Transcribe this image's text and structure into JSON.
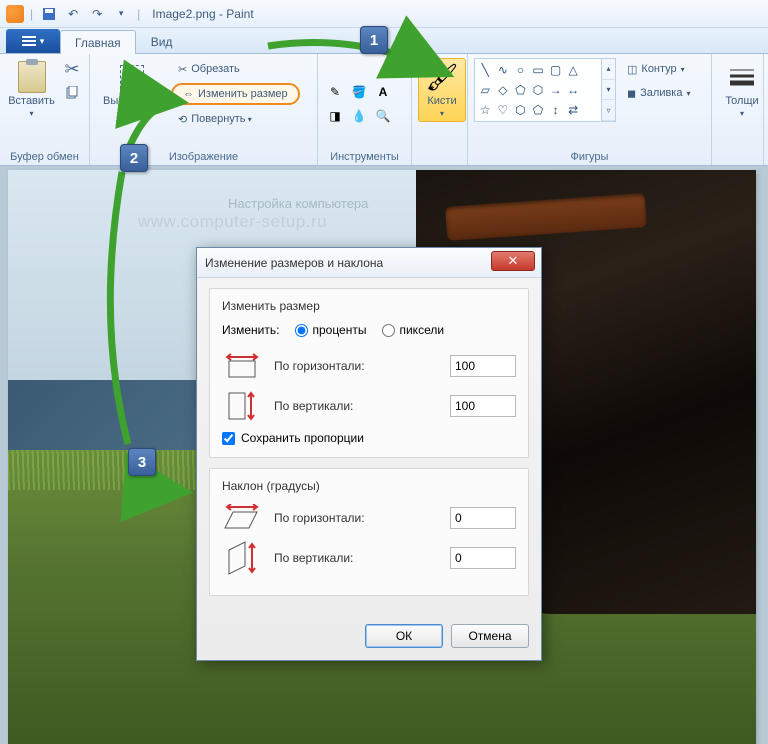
{
  "title": "Image2.png - Paint",
  "tabs": {
    "main": "Главная",
    "view": "Вид"
  },
  "groups": {
    "clipboard": "Буфер обмен",
    "image": "Изображение",
    "tools": "Инструменты",
    "shapes": "Фигуры",
    "size_label": "Толщи",
    "paste": "Вставить",
    "select": "Выделить",
    "crop": "Обрезать",
    "resize": "Изменить размер",
    "rotate": "Повернуть",
    "brushes": "Кисти",
    "outline": "Контур",
    "fill": "Заливка"
  },
  "watermark": {
    "line1": "Настройка компьютера",
    "line2": "www.computer-setup.ru"
  },
  "badges": {
    "one": "1",
    "two": "2",
    "three": "3"
  },
  "dialog": {
    "title": "Изменение размеров и наклона",
    "resize_legend": "Изменить размер",
    "change_label": "Изменить:",
    "percent": "проценты",
    "pixels": "пиксели",
    "horiz": "По горизонтали:",
    "vert": "По вертикали:",
    "h_val": "100",
    "v_val": "100",
    "keep_aspect": "Сохранить пропорции",
    "skew_legend": "Наклон (градусы)",
    "skew_h_val": "0",
    "skew_v_val": "0",
    "ok": "ОК",
    "cancel": "Отмена"
  }
}
